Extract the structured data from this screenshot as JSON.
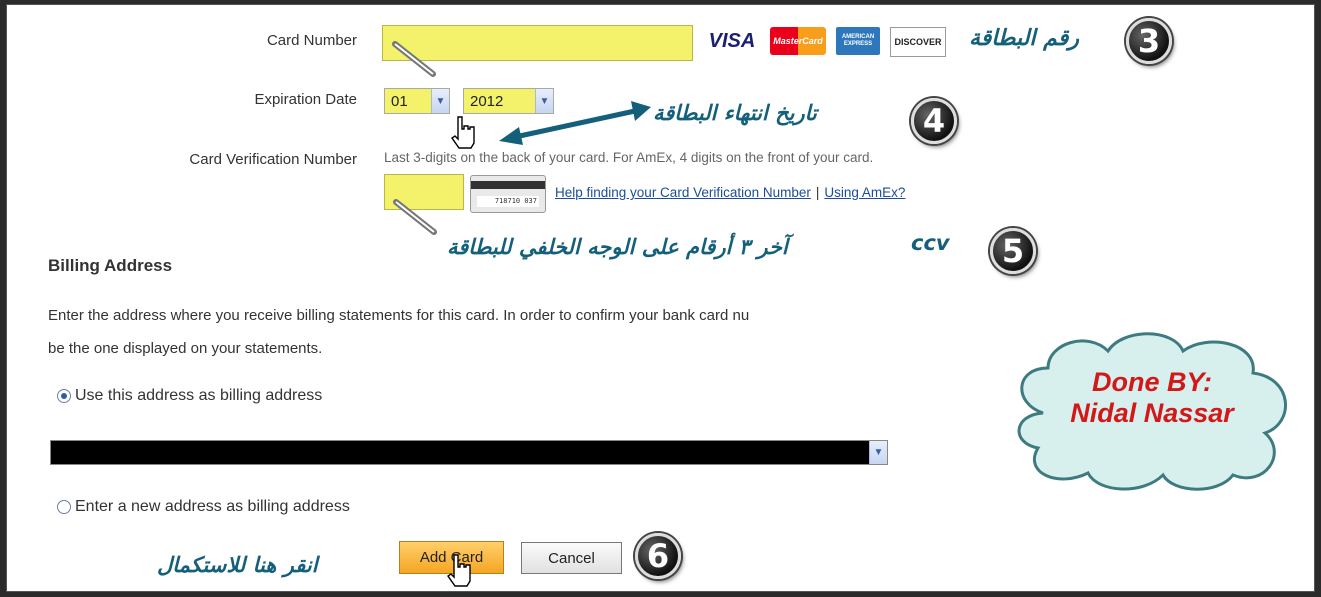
{
  "card_number": {
    "label": "Card Number",
    "value": ""
  },
  "card_logos": [
    "VISA",
    "MasterCard",
    "AMERICAN EXPRESS",
    "DISCOVER"
  ],
  "expiration": {
    "label": "Expiration Date",
    "month": "01",
    "year": "2012"
  },
  "cvv": {
    "label": "Card Verification Number",
    "hint": "Last 3-digits on the back of your card. For AmEx, 4 digits on the front of your card.",
    "value": "",
    "card_image_text": "718710 037",
    "help_link": "Help finding your Card Verification Number",
    "separator": "|",
    "amex_link": "Using AmEx?"
  },
  "billing": {
    "heading": "Billing Address",
    "description_line1": "Enter the address where you receive billing statements for this card. In order to confirm your bank card nu",
    "description_line2": "be the one displayed on your statements.",
    "option_existing": "Use this address as billing address",
    "option_new": "Enter a new address as billing address",
    "selected_option": "existing"
  },
  "buttons": {
    "add": "Add Card",
    "cancel": "Cancel"
  },
  "annotations": {
    "step3": {
      "number": "3",
      "text": "رقم البطاقة"
    },
    "step4": {
      "number": "4",
      "text": "تاريخ انتهاء البطاقة"
    },
    "step5": {
      "number": "5",
      "text": "آخر ٣ أرقام على الوجه الخلفي للبطاقة",
      "tag": "ccv"
    },
    "step6": {
      "number": "6",
      "text": "انقر هنا للاستكمال"
    },
    "credit_line1": "Done BY:",
    "credit_line2": "Nidal Nassar"
  },
  "colors": {
    "input_highlight": "#f4f26a",
    "annotation": "#14607a",
    "credit": "#d21818",
    "add_button": "#f5a623"
  }
}
